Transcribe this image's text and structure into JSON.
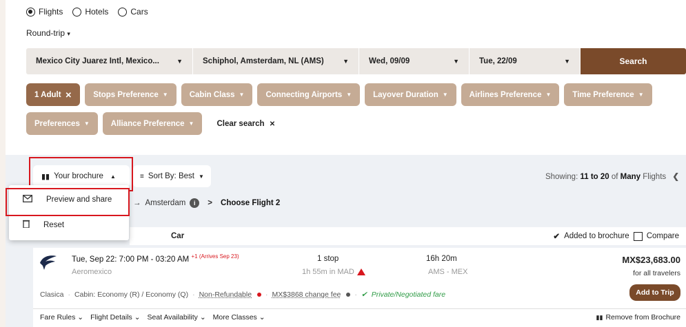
{
  "trip_types": {
    "flights": "Flights",
    "hotels": "Hotels",
    "cars": "Cars"
  },
  "trip_mode": "Round-trip",
  "search": {
    "origin": "Mexico City Juarez Intl, Mexico...",
    "destination": "Schiphol, Amsterdam, NL (AMS)",
    "depart": "Wed, 09/09",
    "return": "Tue, 22/09",
    "button": "Search"
  },
  "filters_row1": [
    "1 Adult",
    "Stops Preference",
    "Cabin Class",
    "Connecting Airports",
    "Layover Duration",
    "Airlines Preference",
    "Time Preference"
  ],
  "filters_row2": [
    "Preferences",
    "Alliance Preference"
  ],
  "clear_search": "Clear search",
  "toolbar": {
    "brochure": "Your brochure",
    "sort": "Sort By: Best",
    "showing_prefix": "Showing:",
    "showing_range": "11 to 20",
    "showing_of": "of",
    "showing_many": "Many",
    "showing_suffix": "Flights"
  },
  "breadcrumb": {
    "city": "Amsterdam",
    "current": "Choose Flight 2"
  },
  "brochure_menu": {
    "preview": "Preview and share",
    "reset": "Reset"
  },
  "table": {
    "car": "Car",
    "added": "Added to brochure",
    "compare": "Compare"
  },
  "flight": {
    "times": "Tue, Sep 22:  7:00 PM - 03:20 AM",
    "arrival_note": "+1 (Arrives Sep 23)",
    "airline": "Aeromexico",
    "stops": "1 stop",
    "layover": "1h 55m in MAD",
    "duration": "16h 20m",
    "route": "AMS - MEX",
    "price": "MX$23,683.00",
    "price_note": "for all travelers",
    "fare_class": "Clasica",
    "cabin": "Cabin: Economy (R) / Economy (Q)",
    "refund": "Non-Refundable",
    "change_fee": "MX$3868 change fee",
    "private": "Private/Negotiated fare",
    "add_button": "Add to Trip"
  },
  "bottom_links": [
    "Fare Rules",
    "Flight Details",
    "Seat Availability",
    "More Classes"
  ],
  "remove": "Remove from Brochure",
  "colors": {
    "brand": "#7a4a2a",
    "chip": "#c5ab95",
    "chip_active": "#95694a",
    "highlight": "#d8171e"
  }
}
